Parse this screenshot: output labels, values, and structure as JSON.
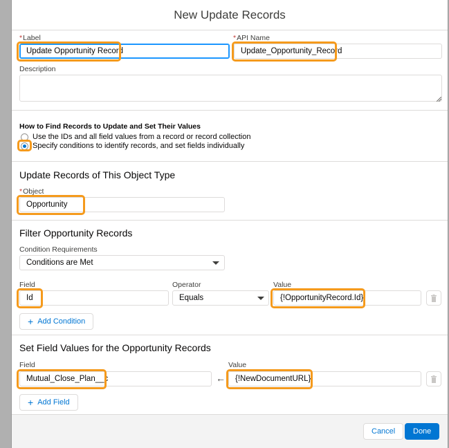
{
  "modal": {
    "title": "New Update Records"
  },
  "label_field": {
    "label": "Label",
    "required_mark": "*",
    "value": "Update Opportunity Record"
  },
  "api_name_field": {
    "label": "API Name",
    "required_mark": "*",
    "value": "Update_Opportunity_Record"
  },
  "description_field": {
    "label": "Description",
    "value": ""
  },
  "how_to_find": {
    "heading": "How to Find Records to Update and Set Their Values",
    "options": [
      {
        "label": "Use the IDs and all field values from a record or record collection",
        "selected": false
      },
      {
        "label": "Specify conditions to identify records, and set fields individually",
        "selected": true
      }
    ]
  },
  "object_section": {
    "title": "Update Records of This Object Type",
    "object_label": "Object",
    "required_mark": "*",
    "object_value": "Opportunity"
  },
  "filter_section": {
    "title": "Filter Opportunity Records",
    "condition_req_label": "Condition Requirements",
    "condition_req_value": "Conditions are Met",
    "field_label": "Field",
    "operator_label": "Operator",
    "value_label": "Value",
    "field_value": "Id",
    "operator_value": "Equals",
    "value_value": "{!OpportunityRecord.Id}",
    "add_condition_label": "Add Condition"
  },
  "set_fields_section": {
    "title": "Set Field Values for the Opportunity Records",
    "field_label": "Field",
    "value_label": "Value",
    "field_value": "Mutual_Close_Plan__c",
    "value_value": "{!NewDocumentURL}",
    "add_field_label": "Add Field"
  },
  "footer": {
    "cancel_label": "Cancel",
    "done_label": "Done"
  },
  "colors": {
    "highlight": "#f59a1c",
    "brand": "#0176d3"
  }
}
